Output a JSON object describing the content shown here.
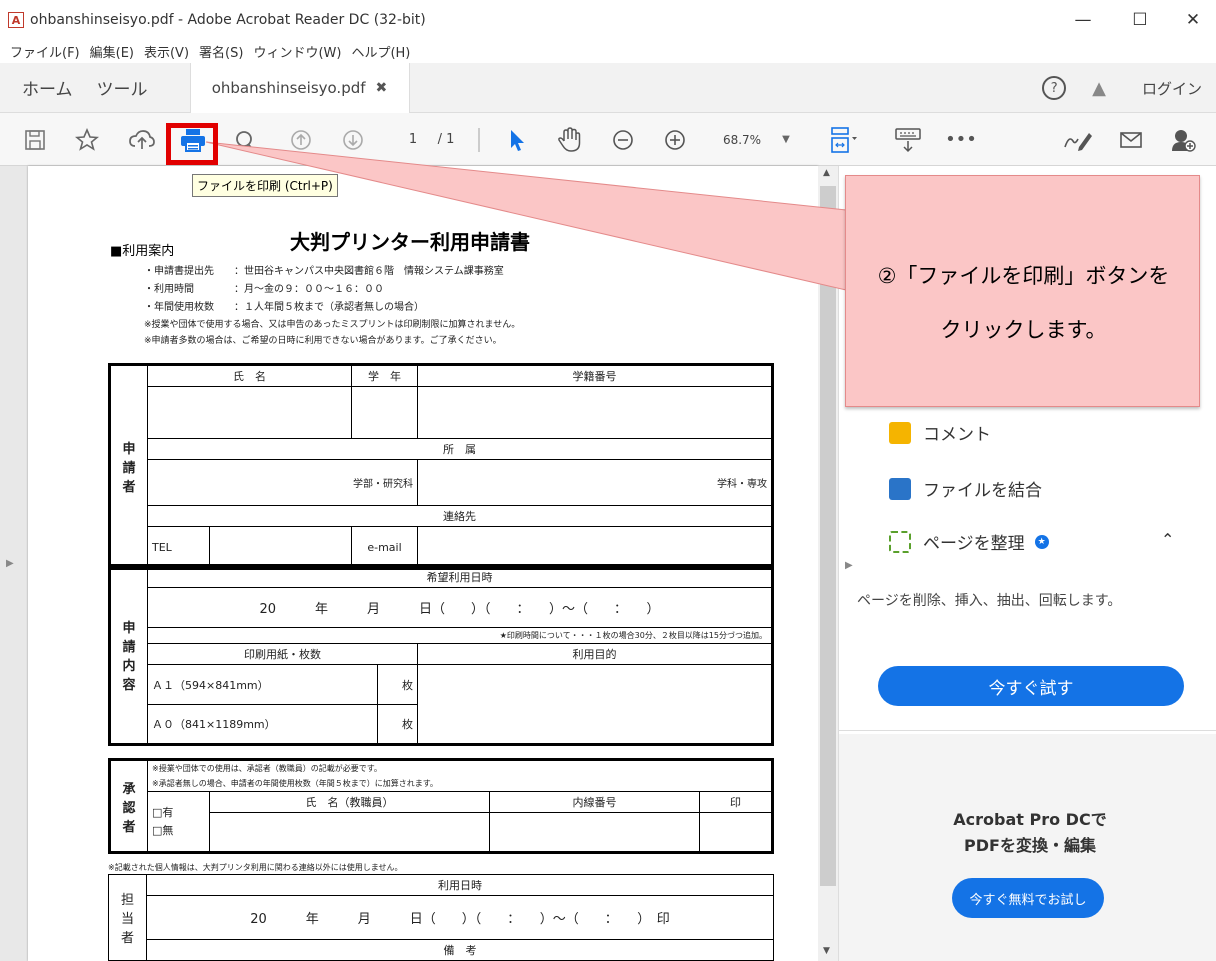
{
  "window": {
    "title": "ohbanshinseisyo.pdf - Adobe Acrobat Reader DC (32-bit)"
  },
  "menu": [
    "ファイル(F)",
    "編集(E)",
    "表示(V)",
    "署名(S)",
    "ウィンドウ(W)",
    "ヘルプ(H)"
  ],
  "tabs": {
    "home": "ホーム",
    "tools": "ツール",
    "document": "ohbanshinseisyo.pdf",
    "login": "ログイン"
  },
  "toolbar": {
    "page_current": "1",
    "page_total": "/ 1",
    "zoom": "68.7%"
  },
  "tooltip": "ファイルを印刷 (Ctrl+P)",
  "callout": {
    "line1": "②「ファイルを印刷」ボタンを",
    "line2": "クリックします。"
  },
  "document": {
    "title": "大判プリンター利用申請書",
    "section": "■利用案内",
    "info": [
      "・申請書提出先　　：世田谷キャンパス中央図書館６階　情報システム課事務室",
      "・利用時間　　　　：月～金の９：００～１６：００",
      "・年間使用枚数　　：１人年間５枚まで（承認者無しの場合）",
      "※授業や団体で使用する場合、又は申告のあったミスプリントは印刷制限に加算されません。",
      "※申請者多数の場合は、ご希望の日時に利用できない場合があります。ご了承ください。"
    ],
    "applicant": {
      "label": "申\n請\n者",
      "name": "氏　名",
      "grade": "学　年",
      "student_no": "学籍番号",
      "affiliation": "所　属",
      "faculty": "学部・研究科",
      "dept": "学科・専攻",
      "contact": "連絡先",
      "tel": "TEL",
      "email": "e-mail"
    },
    "request": {
      "label": "申\n請\n内\n容",
      "date_header": "希望利用日時",
      "date_line": "20　　　年　　　月　　　日（　　）（　　：　　）～（　　：　　）",
      "note": "★印刷時間について・・・１枚の場合30分、２枚目以降は15分づつ追加。",
      "paper": "印刷用紙・枚数",
      "purpose": "利用目的",
      "a1": "Ａ１（594×841mm）",
      "a0": "Ａ０（841×1189mm）",
      "sheet": "枚"
    },
    "approver": {
      "label": "承\n認\n者",
      "note1": "※授業や団体での使用は、承認者（教職員）の記載が必要です。",
      "note2": "※承認者無しの場合、申請者の年間使用枚数（年間５枚まで）に加算されます。",
      "name": "氏　名（教職員）",
      "ext": "内線番号",
      "seal": "印",
      "yes": "□有",
      "no": "□無"
    },
    "privacy": "※記載された個人情報は、大判プリンタ利用に関わる連絡以外には使用しません。",
    "staff": {
      "label": "担\n当\n者",
      "date_header": "利用日時",
      "date_line": "20　　　年　　　月　　　日（　　）（　　：　　）～（　　：　　）　印",
      "remarks": "備　考"
    }
  },
  "right_panel": {
    "comment": "コメント",
    "combine": "ファイルを結合",
    "organize": "ページを整理",
    "organize_desc": "ページを削除、挿入、抽出、回転します。",
    "try_now": "今すぐ試す",
    "promo_line1": "Acrobat Pro DCで",
    "promo_line2": "PDFを変換・編集",
    "free_trial": "今すぐ無料でお試し"
  }
}
